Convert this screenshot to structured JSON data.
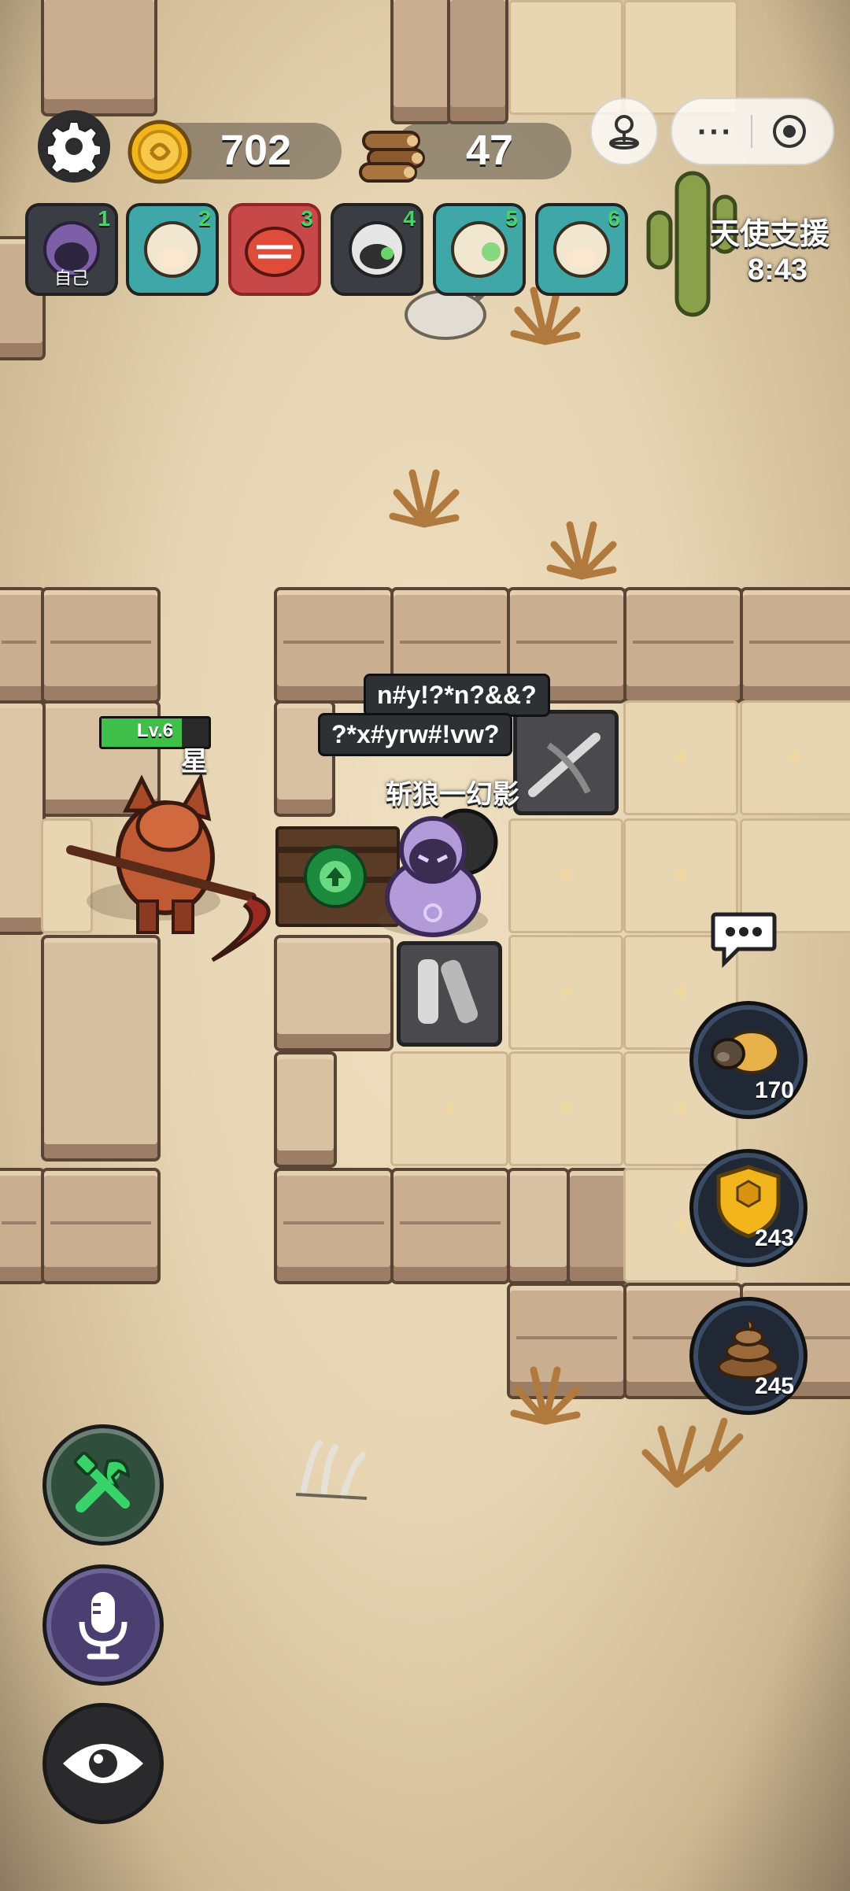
{
  "top_bar": {
    "coins": "702",
    "wood": "47"
  },
  "players": [
    {
      "num": "1",
      "label": "自己",
      "color": "#7d5fa8"
    },
    {
      "num": "2",
      "label": "",
      "color": "#f1e6d0"
    },
    {
      "num": "3",
      "label": "",
      "color": "#c64848"
    },
    {
      "num": "4",
      "label": "",
      "color": "#2f2f30"
    },
    {
      "num": "5",
      "label": "",
      "color": "#f1e6d0"
    },
    {
      "num": "6",
      "label": "",
      "color": "#f1e6d0"
    }
  ],
  "support": {
    "title": "天使支援",
    "timer": "8:43"
  },
  "enemy": {
    "level": "Lv.6",
    "name_fragment": "星",
    "hp_fraction": 0.75
  },
  "chat_bubbles": {
    "first": "n#y!?*n?&&?",
    "second": "?*x#yrw#!vw?"
  },
  "player_name": "斩狼一幻影",
  "resources": {
    "pig": "170",
    "shield": "243",
    "poop": "245"
  },
  "colors": {
    "accent_green": "#3fbf4a",
    "gold": "#f2b51c"
  },
  "icons": [
    "gear-icon",
    "coin-icon",
    "wood-icon",
    "joystick-icon",
    "more-icon",
    "record-icon",
    "chat-icon",
    "pig-icon",
    "shield-icon",
    "poop-icon",
    "tools-icon",
    "microphone-icon",
    "eye-icon",
    "upgrade-arrow-icon"
  ]
}
